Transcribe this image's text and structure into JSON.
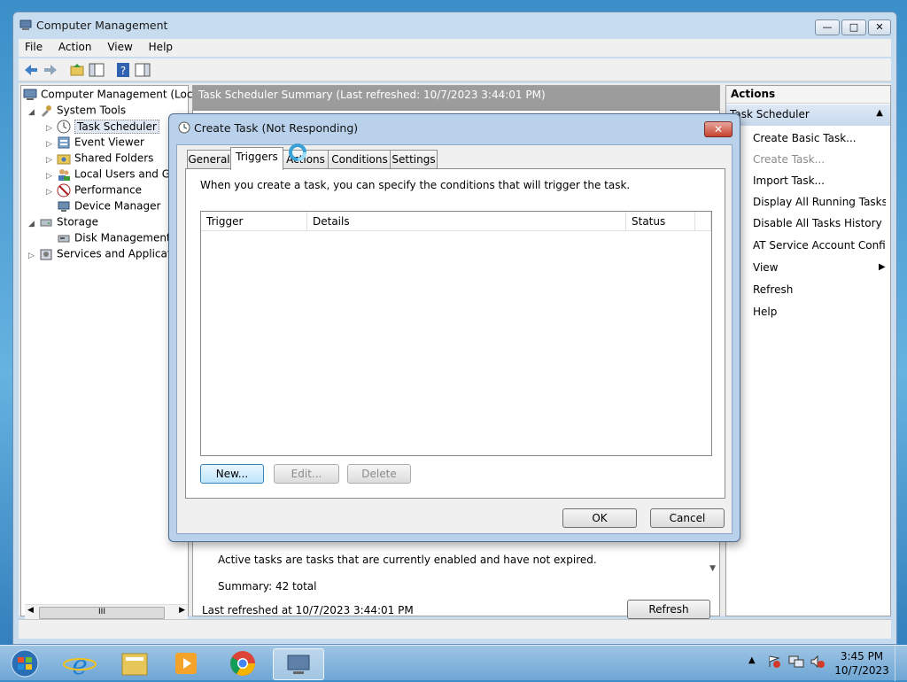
{
  "window": {
    "title": "Computer Management",
    "menu": [
      "File",
      "Action",
      "View",
      "Help"
    ]
  },
  "tree": {
    "root": "Computer Management (Local)",
    "items": [
      {
        "label": "System Tools",
        "icon": "tools-icon"
      },
      {
        "label": "Task Scheduler",
        "icon": "clock-icon"
      },
      {
        "label": "Event Viewer",
        "icon": "event-viewer-icon"
      },
      {
        "label": "Shared Folders",
        "icon": "shared-folders-icon"
      },
      {
        "label": "Local Users and Groups",
        "icon": "users-icon"
      },
      {
        "label": "Performance",
        "icon": "performance-icon"
      },
      {
        "label": "Device Manager",
        "icon": "device-manager-icon"
      },
      {
        "label": "Storage",
        "icon": "storage-icon"
      },
      {
        "label": "Disk Management",
        "icon": "disk-icon"
      },
      {
        "label": "Services and Applications",
        "icon": "services-icon"
      }
    ],
    "scroll_grip": "III"
  },
  "center": {
    "summary_header": "Task Scheduler Summary (Last refreshed: 10/7/2023 3:44:01 PM)",
    "active_tasks_text": "Active tasks are tasks that are currently enabled and have not expired.",
    "summary_total": "Summary: 42 total",
    "last_refreshed": "Last refreshed at 10/7/2023 3:44:01 PM",
    "refresh_button": "Refresh"
  },
  "actions": {
    "header": "Actions",
    "section": "Task Scheduler",
    "items": [
      {
        "label": "Create Basic Task...",
        "enabled": true
      },
      {
        "label": "Create Task...",
        "enabled": false
      },
      {
        "label": "Import Task...",
        "enabled": true
      },
      {
        "label": "Display All Running Tasks",
        "enabled": true
      },
      {
        "label": "Disable All Tasks History",
        "enabled": true
      },
      {
        "label": "AT Service Account Configuration",
        "enabled": true
      },
      {
        "label": "View",
        "enabled": true
      },
      {
        "label": "Refresh",
        "enabled": true
      },
      {
        "label": "Help",
        "enabled": true
      }
    ]
  },
  "dialog": {
    "title": "Create Task (Not Responding)",
    "tabs": [
      "General",
      "Triggers",
      "Actions",
      "Conditions",
      "Settings"
    ],
    "active_tab": "Triggers",
    "description": "When you create a task, you can specify the conditions that will trigger the task.",
    "columns": [
      "Trigger",
      "Details",
      "Status"
    ],
    "buttons": {
      "new": "New...",
      "edit": "Edit...",
      "delete": "Delete",
      "ok": "OK",
      "cancel": "Cancel"
    }
  },
  "taskbar": {
    "time": "3:45 PM",
    "date": "10/7/2023",
    "apps": [
      "start-orb-icon",
      "internet-explorer-icon",
      "file-explorer-icon",
      "media-player-icon",
      "chrome-icon",
      "computer-management-icon"
    ]
  },
  "colors": {
    "title_bar": "#c7dcef",
    "dialog_frame": "#b9d1ea",
    "summary_header": "#9c9c9c",
    "close_button": "#c6422f"
  }
}
